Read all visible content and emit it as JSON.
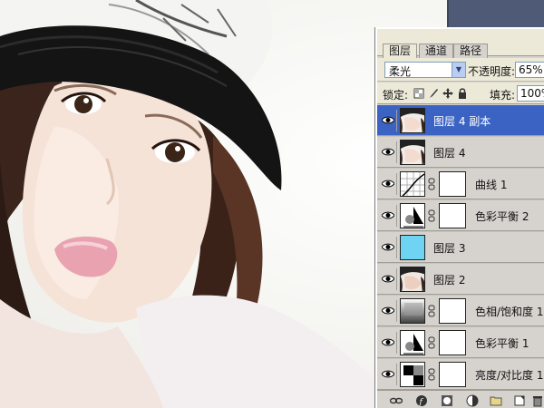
{
  "panel": {
    "tabs": [
      {
        "label": "图层"
      },
      {
        "label": "通道"
      },
      {
        "label": "路径"
      }
    ],
    "blend_mode": "柔光",
    "opacity_label": "不透明度:",
    "opacity_value": "65%",
    "lock_label": "锁定:",
    "fill_label": "填充:",
    "fill_value": "100%",
    "layers": [
      {
        "name": "图层 4 副本",
        "type": "photo",
        "selected": true
      },
      {
        "name": "图层 4",
        "type": "photo",
        "selected": false
      },
      {
        "name": "曲线 1",
        "type": "adjustment-curves",
        "selected": false
      },
      {
        "name": "色彩平衡 2",
        "type": "adjustment-balance",
        "selected": false
      },
      {
        "name": "图层 3",
        "type": "solid-cyan",
        "selected": false
      },
      {
        "name": "图层 2",
        "type": "photo",
        "selected": false
      },
      {
        "name": "色相/饱和度 1",
        "type": "adjustment-hue",
        "selected": false
      },
      {
        "name": "色彩平衡 1",
        "type": "adjustment-balance",
        "selected": false
      },
      {
        "name": "亮度/对比度 1",
        "type": "adjustment-brightness",
        "selected": false
      }
    ]
  },
  "colors": {
    "selected_row": "#3b63c4",
    "solid_layer_fill": "#6fd3f2",
    "panel_bg": "#d6d3ce"
  },
  "icons": {
    "lock_icons": [
      "lock-transparency-icon",
      "lock-brush-icon",
      "lock-move-icon",
      "lock-all-icon"
    ],
    "bottom_icons": [
      "link-layers-icon",
      "layer-style-icon",
      "mask-icon",
      "new-adjustment-icon",
      "new-group-icon",
      "new-layer-icon",
      "trash-icon"
    ]
  }
}
